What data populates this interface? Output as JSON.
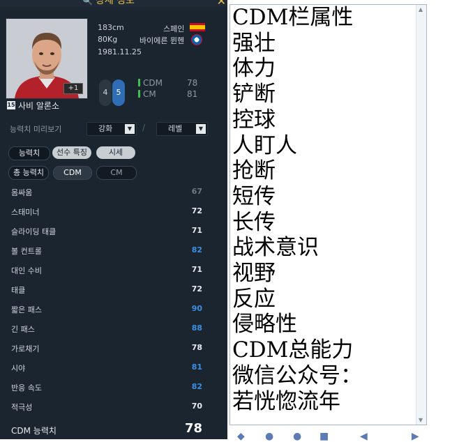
{
  "header": {
    "title": "상세 정보"
  },
  "player": {
    "name": "사비 알론소",
    "season_badge": "15",
    "grade": "+1",
    "height": "183cm",
    "weight": "80Kg",
    "birthdate": "1981.11.25",
    "nation": "스페인",
    "club": "바이에른 뮌헨",
    "foot_left": "4",
    "foot_right": "5",
    "positions": [
      {
        "pos": "CDM",
        "ovr": "78"
      },
      {
        "pos": "CM",
        "ovr": "81"
      }
    ]
  },
  "preview": {
    "label": "능력치 미리보기",
    "enhance_label": "강화",
    "level_label": "레벨",
    "separator": "/"
  },
  "tabs": {
    "ability": "능력치",
    "traits": "선수 특징",
    "market": "시세"
  },
  "subtabs": {
    "total": "총 능력치",
    "cdm": "CDM",
    "cm": "CM"
  },
  "stats": [
    {
      "name": "몸싸움",
      "value": "67",
      "color": "#6f7882"
    },
    {
      "name": "스태미너",
      "value": "72",
      "color": "#e8ecef"
    },
    {
      "name": "슬라이딩 태클",
      "value": "71",
      "color": "#e8ecef"
    },
    {
      "name": "볼 컨트롤",
      "value": "82",
      "color": "#3c8fe0"
    },
    {
      "name": "대인 수비",
      "value": "71",
      "color": "#e8ecef"
    },
    {
      "name": "태클",
      "value": "72",
      "color": "#e8ecef"
    },
    {
      "name": "짧은 패스",
      "value": "90",
      "color": "#3c8fe0"
    },
    {
      "name": "긴 패스",
      "value": "88",
      "color": "#3c8fe0"
    },
    {
      "name": "가로채기",
      "value": "78",
      "color": "#e8ecef"
    },
    {
      "name": "시야",
      "value": "81",
      "color": "#3c8fe0"
    },
    {
      "name": "반응 속도",
      "value": "82",
      "color": "#3c8fe0"
    },
    {
      "name": "적극성",
      "value": "70",
      "color": "#e8ecef"
    }
  ],
  "total": {
    "label": "CDM 능력치",
    "value": "78"
  },
  "notepad": {
    "lines": [
      "CDM栏属性",
      "强壮",
      "体力",
      "铲断",
      "控球",
      "人盯人",
      "抢断",
      "短传",
      "长传",
      "战术意识",
      "视野",
      "反应",
      "侵略性",
      "CDM总能力",
      "微信公众号：",
      "若恍惚流年"
    ]
  }
}
